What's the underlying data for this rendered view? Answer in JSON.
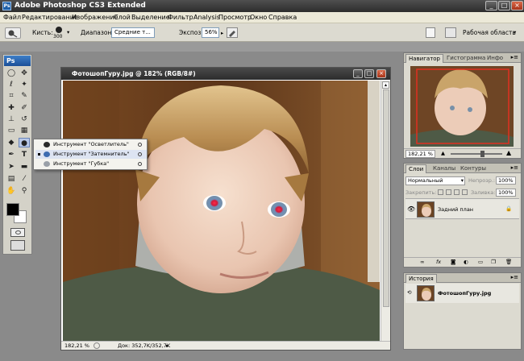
{
  "app": {
    "title": "Adobe Photoshop CS3 Extended",
    "logo": "Ps"
  },
  "menu": [
    "Файл",
    "Редактирование",
    "Изображение",
    "Слой",
    "Выделение",
    "Фильтр",
    "Analysis",
    "Просмотр",
    "Окно",
    "Справка"
  ],
  "options_bar": {
    "brush_label": "Кисть:",
    "brush_size": "300",
    "range_label": "Диапазон:",
    "range_value": "Средние т...",
    "exposure_label": "Экспоз.:",
    "exposure_value": "56%",
    "workspace_label": "Рабочая область"
  },
  "tools": {
    "logo": "Ps"
  },
  "flyout": {
    "items": [
      {
        "label": "Инструмент \"Осветлитель\"",
        "active": false
      },
      {
        "label": "Инструмент \"Затемнитель\"",
        "active": true
      },
      {
        "label": "Инструмент \"Губка\"",
        "active": false
      }
    ]
  },
  "document": {
    "title": "ФотошопГуру.jpg @ 182% (RGB/8#)",
    "zoom": "182,21 %",
    "doc_size": "Док: 352,7K/352,7K"
  },
  "navigator": {
    "tabs": [
      "Навигатор",
      "Гистограмма",
      "Инфо"
    ],
    "zoom": "182,21 %"
  },
  "layers": {
    "tabs": [
      "Слои",
      "Каналы",
      "Контуры"
    ],
    "blend_mode": "Нормальный",
    "opacity_label": "Непрозр.:",
    "opacity_value": "100%",
    "lock_label": "Закрепить:",
    "fill_label": "Заливка:",
    "fill_value": "100%",
    "layer_name": "Задний план"
  },
  "history": {
    "tabs": [
      "История"
    ],
    "item": "ФотошопГуру.jpg"
  },
  "colors": {
    "accent": "#2b5fb0",
    "titlebar": "#3a3a3a",
    "menubar": "#ece9d8",
    "panel": "#dcdad0"
  }
}
